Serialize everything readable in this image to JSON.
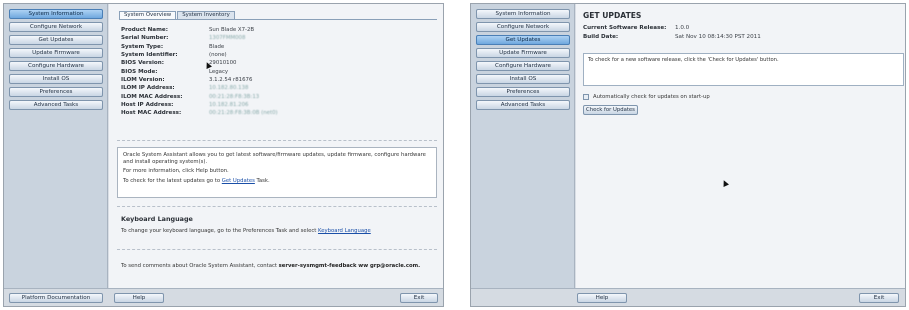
{
  "left": {
    "nav": [
      {
        "label": "System Information"
      },
      {
        "label": "Configure Network"
      },
      {
        "label": "Get Updates"
      },
      {
        "label": "Update Firmware"
      },
      {
        "label": "Configure Hardware"
      },
      {
        "label": "Install OS"
      },
      {
        "label": "Preferences"
      },
      {
        "label": "Advanced Tasks"
      }
    ],
    "active_nav": "System Information",
    "tabs": [
      {
        "label": "System Overview"
      },
      {
        "label": "System Inventory"
      }
    ],
    "inventory": [
      {
        "label": "Product Name:",
        "value": "Sun Blade X7-2B"
      },
      {
        "label": "Serial Number:",
        "value": "1307FMM008"
      },
      {
        "label": "System Type:",
        "value": "Blade"
      },
      {
        "label": "System Identifier:",
        "value": "(none)"
      },
      {
        "label": "BIOS Version:",
        "value": "29010100"
      },
      {
        "label": "BIOS Mode:",
        "value": "Legacy"
      },
      {
        "label": "ILOM Version:",
        "value": "3.1.2.54 r81676"
      },
      {
        "label": "ILOM IP Address:",
        "value": "10.182.80.138"
      },
      {
        "label": "ILOM MAC Address:",
        "value": "00:21:28:F8:3B:13"
      },
      {
        "label": "Host IP Address:",
        "value": "10.182.81.206"
      },
      {
        "label": "Host MAC Address:",
        "value": "00:21:28:F8:3B:0B (net0)"
      }
    ],
    "info": {
      "line1": "Oracle System Assistant allows you to get latest software/firmware updates, update firmware, configure hardware and install operating system(s).",
      "line2": "For more information, click Help button.",
      "line3_prefix": "To check for the latest updates go to",
      "line3_link": "Get Updates",
      "line3_suffix": "Task."
    },
    "keyboard": {
      "title": "Keyboard Language",
      "text_prefix": "To change your keyboard language, go to the Preferences Task and select",
      "link": "Keyboard Language"
    },
    "feedback": {
      "text_prefix": "To send comments about Oracle System Assistant, contact",
      "email": "server-sysmgmt-feedback ww grp@oracle.com."
    },
    "bottom": {
      "platform_doc": "Platform Documentation",
      "help": "Help",
      "exit": "Exit"
    }
  },
  "right": {
    "nav": [
      {
        "label": "System Information"
      },
      {
        "label": "Configure Network"
      },
      {
        "label": "Get Updates"
      },
      {
        "label": "Update Firmware"
      },
      {
        "label": "Configure Hardware"
      },
      {
        "label": "Install OS"
      },
      {
        "label": "Preferences"
      },
      {
        "label": "Advanced Tasks"
      }
    ],
    "active_nav": "Get Updates",
    "title": "GET UPDATES",
    "release_label": "Current Software Release:",
    "release_value": "1.0.0",
    "build_label": "Build Date:",
    "build_value": "Sat Nov 10 08:14:30 PST 2011",
    "message": "To check for a new software release, click the 'Check for Updates' button.",
    "auto_check_label": "Automatically check for updates on start-up",
    "check_button": "Check for Updates",
    "bottom": {
      "help": "Help",
      "exit": "Exit"
    }
  },
  "colors": {
    "accent": "#6fa8de",
    "panel_bg": "#d9dee5",
    "sidebar_bg": "#c9d3de",
    "link": "#1a4fa8"
  }
}
